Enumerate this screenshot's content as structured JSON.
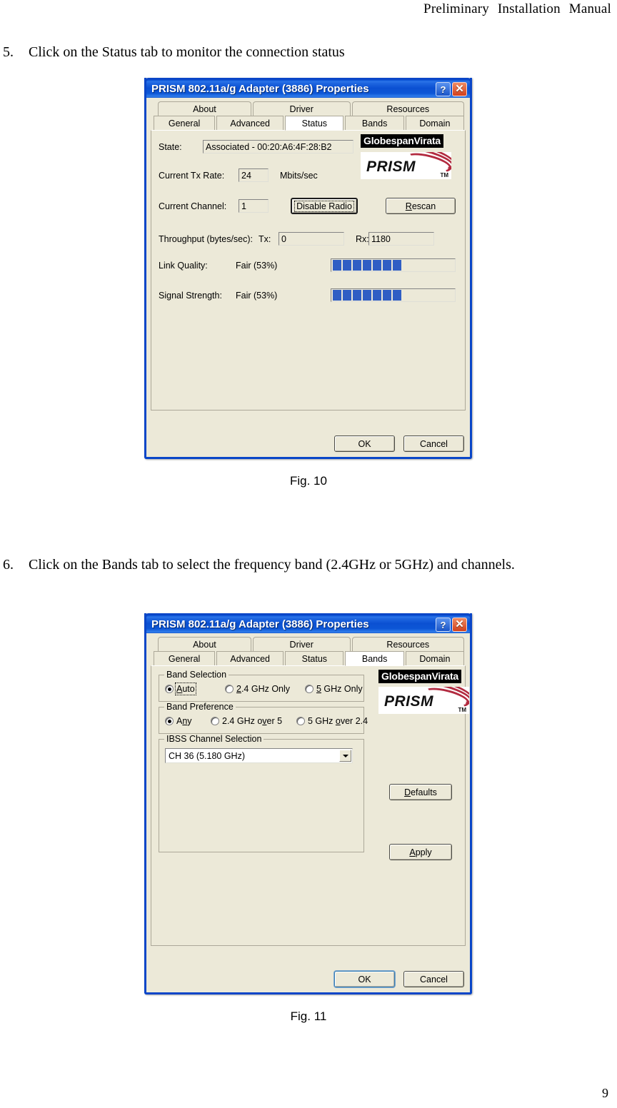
{
  "page": {
    "header_words": [
      "Preliminary",
      "Installation",
      "Manual"
    ],
    "number": "9"
  },
  "steps": [
    {
      "num": "5.",
      "text": "Click on the Status tab to monitor the connection status"
    },
    {
      "num": "6.",
      "text": "Click on the Bands tab to select the frequency band (2.4GHz or 5GHz) and channels."
    }
  ],
  "captions": {
    "fig10": "Fig. 10",
    "fig11": "Fig. 11"
  },
  "dialog": {
    "title": "PRISM 802.11a/g Adapter (3886) Properties",
    "titlebar_buttons": {
      "help": "?",
      "close": "✕"
    },
    "tabs_row1": [
      "About",
      "Driver",
      "Resources"
    ],
    "tabs_row2": [
      "General",
      "Advanced",
      "Status",
      "Bands",
      "Domain"
    ],
    "footer": {
      "ok": "OK",
      "cancel": "Cancel"
    },
    "logos": {
      "globespan": "GlobespanVirata",
      "prism": "PRISM",
      "tm": "TM"
    }
  },
  "status_tab": {
    "selected_tab": "Status",
    "state_label": "State:",
    "state_value": "Associated - 00:20:A6:4F:28:B2",
    "tx_rate_label": "Current Tx Rate:",
    "tx_rate_value": "24",
    "tx_rate_units": "Mbits/sec",
    "channel_label": "Current Channel:",
    "channel_value": "1",
    "disable_radio_button": "Disable Radio",
    "rescan_button": "Rescan",
    "throughput_label": "Throughput (bytes/sec):",
    "tx_label": "Tx:",
    "tx_value": "0",
    "rx_label": "Rx:",
    "rx_value": "1180",
    "link_quality_label": "Link Quality:",
    "link_quality_value": "Fair (53%)",
    "link_quality_segments": 7,
    "signal_strength_label": "Signal Strength:",
    "signal_strength_value": "Fair (53%)",
    "signal_strength_segments": 7,
    "meter_color": "#2f5ec4"
  },
  "bands_tab": {
    "selected_tab": "Bands",
    "band_selection": {
      "title": "Band Selection",
      "options": [
        "Auto",
        "2.4 GHz Only",
        "5 GHz Only"
      ],
      "selected": "Auto"
    },
    "band_preference": {
      "title": "Band Preference",
      "options": [
        "Any",
        "2.4 GHz over 5",
        "5 GHz over 2.4"
      ],
      "selected": "Any"
    },
    "ibss": {
      "title": "IBSS Channel Selection",
      "selected_channel": "CH 36    (5.180 GHz)"
    },
    "defaults_button": "Defaults",
    "apply_button": "Apply"
  }
}
